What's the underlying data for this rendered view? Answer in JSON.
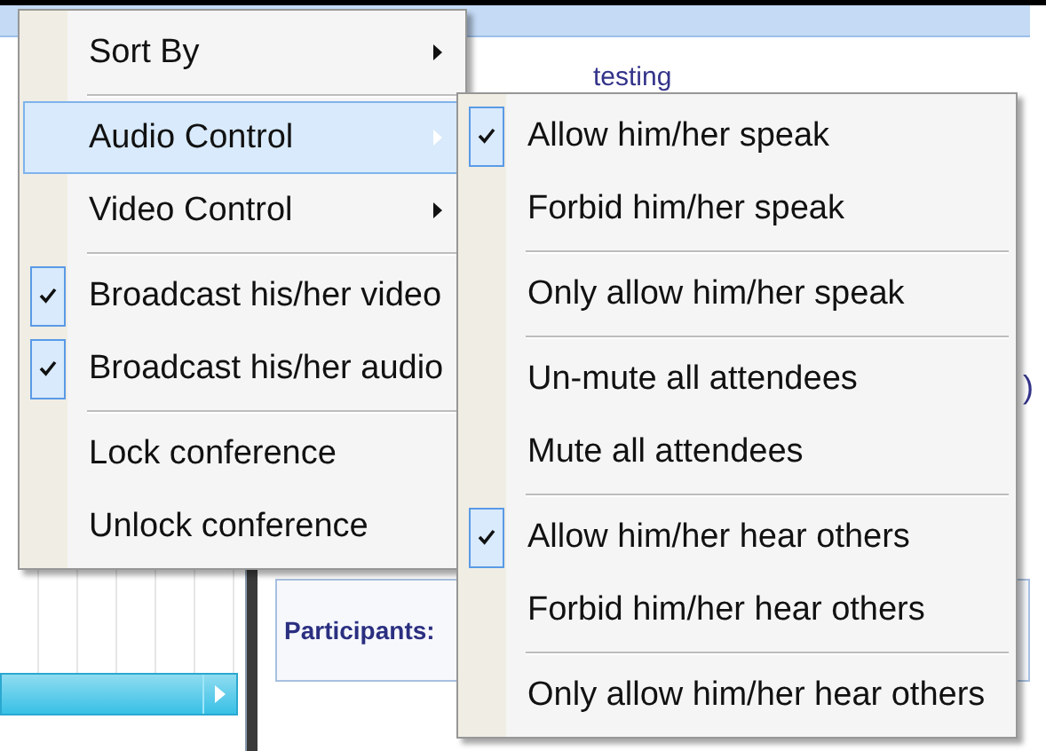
{
  "background_window": {
    "note_text": "testing",
    "text_fragment": ")",
    "participants_label": "Participants:"
  },
  "context_menu": {
    "items": [
      {
        "kind": "item",
        "label": "Sort By",
        "checked": false,
        "selected": false,
        "has_submenu": true
      },
      {
        "kind": "separator"
      },
      {
        "kind": "item",
        "label": "Audio Control",
        "checked": false,
        "selected": true,
        "has_submenu": true
      },
      {
        "kind": "item",
        "label": "Video Control",
        "checked": false,
        "selected": false,
        "has_submenu": true
      },
      {
        "kind": "separator"
      },
      {
        "kind": "item",
        "label": "Broadcast his/her video",
        "checked": true,
        "selected": false,
        "has_submenu": false
      },
      {
        "kind": "item",
        "label": "Broadcast his/her audio",
        "checked": true,
        "selected": false,
        "has_submenu": false
      },
      {
        "kind": "separator"
      },
      {
        "kind": "item",
        "label": "Lock conference",
        "checked": false,
        "selected": false,
        "has_submenu": false
      },
      {
        "kind": "item",
        "label": "Unlock conference",
        "checked": false,
        "selected": false,
        "has_submenu": false
      }
    ]
  },
  "submenu": {
    "items": [
      {
        "kind": "item",
        "label": "Allow him/her speak",
        "checked": true
      },
      {
        "kind": "item",
        "label": "Forbid him/her speak",
        "checked": false
      },
      {
        "kind": "separator"
      },
      {
        "kind": "item",
        "label": "Only allow him/her speak",
        "checked": false
      },
      {
        "kind": "separator"
      },
      {
        "kind": "item",
        "label": "Un-mute all attendees",
        "checked": false
      },
      {
        "kind": "item",
        "label": "Mute all attendees",
        "checked": false
      },
      {
        "kind": "separator"
      },
      {
        "kind": "item",
        "label": "Allow him/her hear others",
        "checked": true
      },
      {
        "kind": "item",
        "label": "Forbid him/her hear others",
        "checked": false
      },
      {
        "kind": "separator"
      },
      {
        "kind": "item",
        "label": "Only allow him/her hear others",
        "checked": false
      }
    ]
  }
}
